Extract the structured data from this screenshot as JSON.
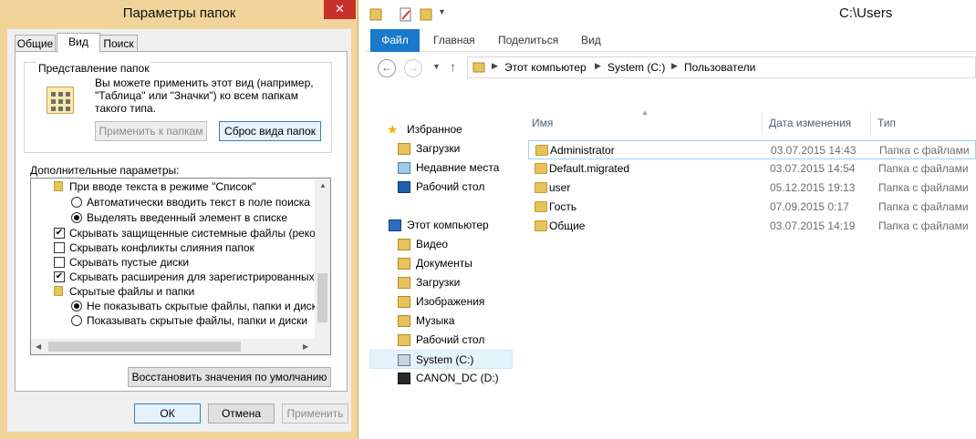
{
  "dialog": {
    "title": "Параметры папок",
    "close_glyph": "✕",
    "tabs": [
      {
        "label": "Общие"
      },
      {
        "label": "Вид"
      },
      {
        "label": "Поиск"
      }
    ],
    "folder_views": {
      "group_title": "Представление папок",
      "description": "Вы можете применить этот вид (например, \"Таблица\" или \"Значки\") ко всем папкам такого типа.",
      "apply_button": "Применить к папкам",
      "reset_button": "Сброс вида папок"
    },
    "advanced": {
      "label": "Дополнительные параметры:",
      "items": [
        {
          "kind": "folder",
          "text": "При вводе текста в режиме \"Список\""
        },
        {
          "kind": "radio",
          "checked": false,
          "text": "Автоматически вводить текст в поле поиска"
        },
        {
          "kind": "radio",
          "checked": true,
          "text": "Выделять введенный элемент в списке"
        },
        {
          "kind": "checkbox",
          "checked": true,
          "text": "Скрывать защищенные системные файлы (рекомен"
        },
        {
          "kind": "checkbox",
          "checked": false,
          "text": "Скрывать конфликты слияния папок"
        },
        {
          "kind": "checkbox",
          "checked": false,
          "text": "Скрывать пустые диски"
        },
        {
          "kind": "checkbox",
          "checked": true,
          "text": "Скрывать расширения для зарегистрированных типо"
        },
        {
          "kind": "folder",
          "text": "Скрытые файлы и папки"
        },
        {
          "kind": "radio",
          "checked": true,
          "text": "Не показывать скрытые файлы, папки и диски"
        },
        {
          "kind": "radio",
          "checked": false,
          "text": "Показывать скрытые файлы, папки и диски"
        }
      ],
      "restore_button": "Восстановить значения по умолчанию"
    },
    "footer": {
      "ok": "ОК",
      "cancel": "Отмена",
      "apply": "Применить"
    }
  },
  "explorer": {
    "title": "C:\\Users",
    "ribbon_tabs": [
      {
        "label": "Файл"
      },
      {
        "label": "Главная"
      },
      {
        "label": "Поделиться"
      },
      {
        "label": "Вид"
      }
    ],
    "breadcrumb": [
      {
        "label": "Этот компьютер"
      },
      {
        "label": "System (C:)"
      },
      {
        "label": "Пользователи"
      }
    ],
    "nav_pane": [
      {
        "label": "Избранное",
        "icon": "star-icon"
      },
      {
        "label": "Загрузки",
        "icon": "downloads-icon"
      },
      {
        "label": "Недавние места",
        "icon": "recent-places-icon"
      },
      {
        "label": "Рабочий стол",
        "icon": "desktop-icon"
      },
      {
        "label": "Этот компьютер",
        "icon": "computer-icon"
      },
      {
        "label": "Видео",
        "icon": "video-folder-icon"
      },
      {
        "label": "Документы",
        "icon": "documents-folder-icon"
      },
      {
        "label": "Загрузки",
        "icon": "downloads-folder-icon"
      },
      {
        "label": "Изображения",
        "icon": "pictures-folder-icon"
      },
      {
        "label": "Музыка",
        "icon": "music-folder-icon"
      },
      {
        "label": "Рабочий стол",
        "icon": "desktop-folder-icon"
      },
      {
        "label": "System (C:)",
        "icon": "system-drive-icon"
      },
      {
        "label": "CANON_DC (D:)",
        "icon": "camera-drive-icon"
      }
    ],
    "columns": {
      "name": "Имя",
      "date": "Дата изменения",
      "type": "Тип"
    },
    "files": [
      {
        "name": "Administrator",
        "date": "03.07.2015 14:43",
        "type": "Папка с файлами"
      },
      {
        "name": "Default.migrated",
        "date": "03.07.2015 14:54",
        "type": "Папка с файлами"
      },
      {
        "name": "user",
        "date": "05.12.2015 19:13",
        "type": "Папка с файлами"
      },
      {
        "name": "Гость",
        "date": "07.09.2015 0:17",
        "type": "Папка с файлами"
      },
      {
        "name": "Общие",
        "date": "03.07.2015 14:19",
        "type": "Папка с файлами"
      }
    ]
  },
  "colors": {
    "dialog_frame": "#f0d49a",
    "close_button": "#c7312a",
    "file_tab": "#1979ca",
    "selection_border": "#99d1ff"
  }
}
